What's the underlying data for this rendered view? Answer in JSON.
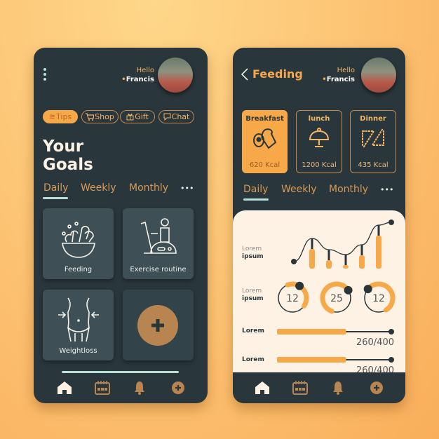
{
  "colors": {
    "background": "#fdc677",
    "phone": "#29363b",
    "card": "#3f4f56",
    "accent": "#f7a94a",
    "panel": "#fdf2e3",
    "mint": "#b9e0d6"
  },
  "user": {
    "greeting": "Hello",
    "name": "Francis"
  },
  "goals_screen": {
    "menu_icon": "vertical-dots-icon",
    "chips": [
      {
        "label": "Tips",
        "icon": "waves-icon",
        "active": true
      },
      {
        "label": "Shop",
        "icon": "cart-icon"
      },
      {
        "label": "Gift",
        "icon": "gift-icon"
      },
      {
        "label": "Chat",
        "icon": "chat-icon"
      }
    ],
    "title_line1": "Your",
    "title_line2": "Goals",
    "tabs": [
      "Daily",
      "Weekly",
      "Monthly"
    ],
    "active_tab": "Daily",
    "more": "•••",
    "cards": [
      {
        "label": "Feeding",
        "icon": "salad-bowl-icon"
      },
      {
        "label": "Exercise routine",
        "icon": "exercise-bike-icon"
      },
      {
        "label": "Weightloss",
        "icon": "waist-icon"
      },
      {
        "label": "",
        "icon": "plus-icon"
      }
    ],
    "nav": [
      "home-icon",
      "calendar-icon",
      "bell-icon",
      "plus-circle-icon"
    ]
  },
  "feeding_screen": {
    "title": "Feeding",
    "meals": [
      {
        "name": "Breakfast",
        "kcal": "620 Kcal",
        "icon": "egg-toast-icon",
        "active": true
      },
      {
        "name": "lunch",
        "kcal": "1200 Kcal",
        "icon": "cloche-icon"
      },
      {
        "name": "Dinner",
        "kcal": "435 Kcal",
        "icon": "sandwich-icon"
      }
    ],
    "tabs": [
      "Daily",
      "Weekly",
      "Monthly"
    ],
    "active_tab": "Daily",
    "more": "•••",
    "stats": {
      "chart_label_1": "Lorem",
      "chart_label_2": "ipsum",
      "bars": [
        28,
        12,
        5,
        19,
        47
      ],
      "rings_label_1": "Lorem",
      "rings_label_2": "ipsum",
      "rings": [
        {
          "value": "12",
          "progress": 0.4
        },
        {
          "value": "25",
          "progress": 0.6
        },
        {
          "value": "12",
          "progress": 0.55
        }
      ],
      "progress": [
        {
          "label": "Lorem",
          "text": "260/400",
          "value": 260,
          "max": 400
        },
        {
          "label": "Lorem",
          "text": "260/400",
          "value": 260,
          "max": 400
        }
      ]
    },
    "nav": [
      "home-icon",
      "calendar-icon",
      "bell-icon",
      "plus-circle-icon"
    ]
  }
}
